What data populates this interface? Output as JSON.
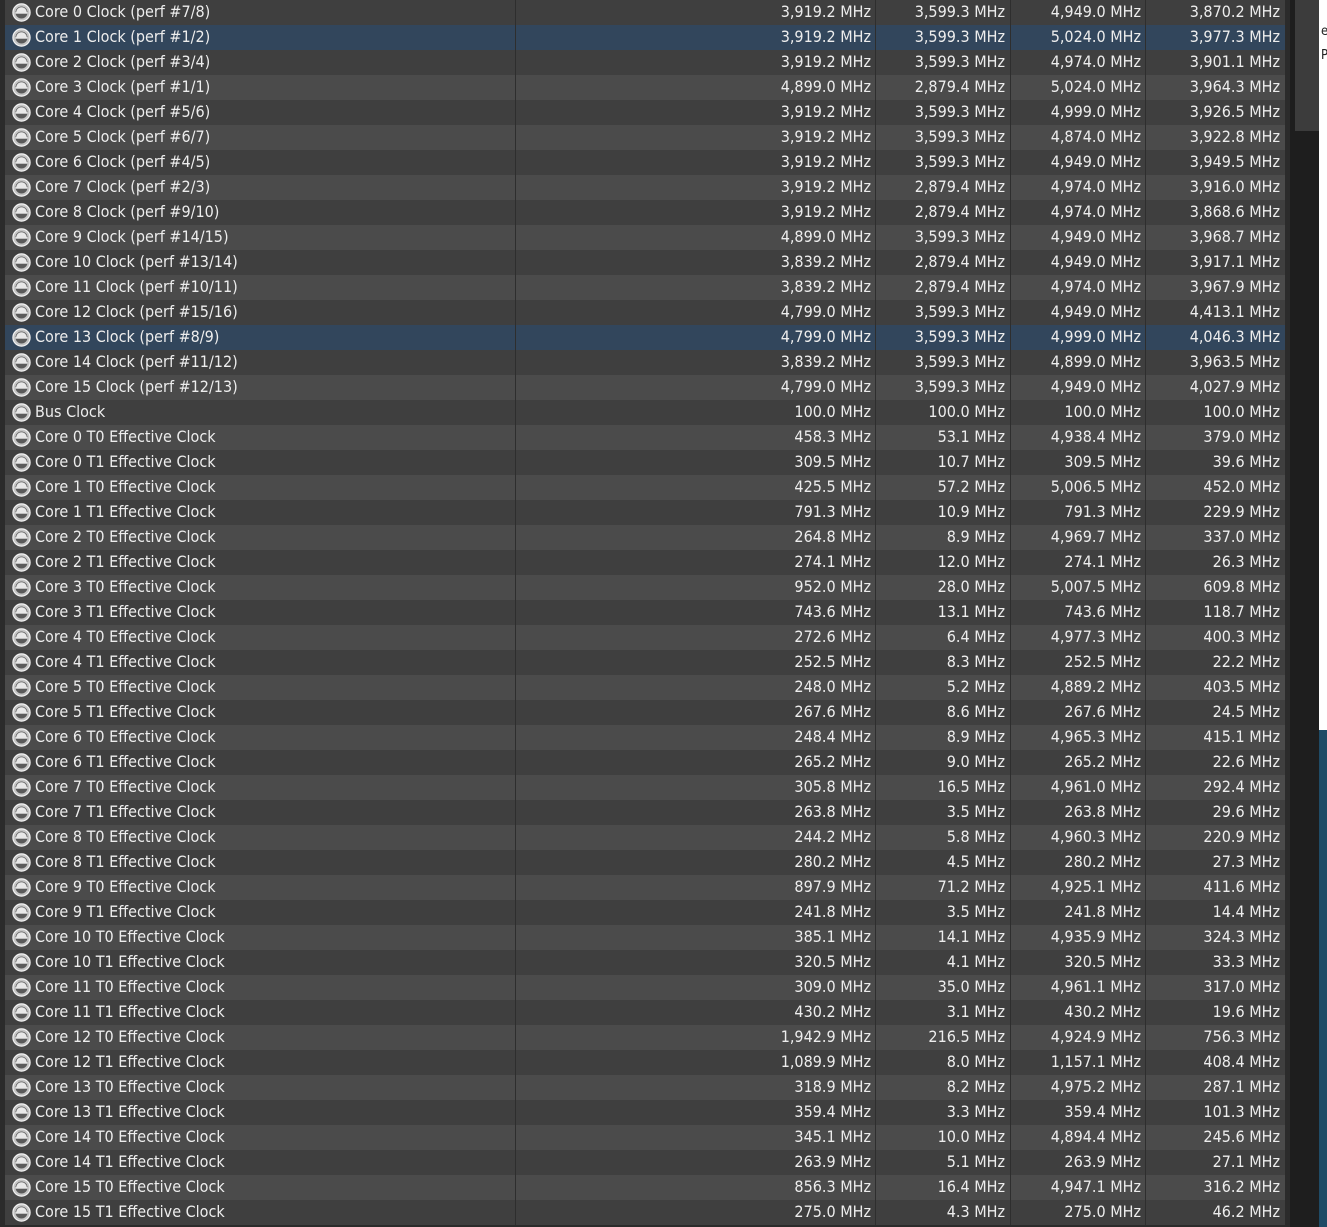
{
  "window_edge": [
    "e",
    "P"
  ],
  "rows": [
    {
      "name": "Core 0 Clock (perf #7/8)",
      "values": [
        "3,919.2 MHz",
        "3,599.3 MHz",
        "4,949.0 MHz",
        "3,870.2 MHz"
      ]
    },
    {
      "name": "Core 1 Clock (perf #1/2)",
      "values": [
        "3,919.2 MHz",
        "3,599.3 MHz",
        "5,024.0 MHz",
        "3,977.3 MHz"
      ],
      "selected": true
    },
    {
      "name": "Core 2 Clock (perf #3/4)",
      "values": [
        "3,919.2 MHz",
        "3,599.3 MHz",
        "4,974.0 MHz",
        "3,901.1 MHz"
      ]
    },
    {
      "name": "Core 3 Clock (perf #1/1)",
      "values": [
        "4,899.0 MHz",
        "2,879.4 MHz",
        "5,024.0 MHz",
        "3,964.3 MHz"
      ]
    },
    {
      "name": "Core 4 Clock (perf #5/6)",
      "values": [
        "3,919.2 MHz",
        "3,599.3 MHz",
        "4,999.0 MHz",
        "3,926.5 MHz"
      ]
    },
    {
      "name": "Core 5 Clock (perf #6/7)",
      "values": [
        "3,919.2 MHz",
        "3,599.3 MHz",
        "4,874.0 MHz",
        "3,922.8 MHz"
      ]
    },
    {
      "name": "Core 6 Clock (perf #4/5)",
      "values": [
        "3,919.2 MHz",
        "3,599.3 MHz",
        "4,949.0 MHz",
        "3,949.5 MHz"
      ]
    },
    {
      "name": "Core 7 Clock (perf #2/3)",
      "values": [
        "3,919.2 MHz",
        "2,879.4 MHz",
        "4,974.0 MHz",
        "3,916.0 MHz"
      ]
    },
    {
      "name": "Core 8 Clock (perf #9/10)",
      "values": [
        "3,919.2 MHz",
        "2,879.4 MHz",
        "4,974.0 MHz",
        "3,868.6 MHz"
      ]
    },
    {
      "name": "Core 9 Clock (perf #14/15)",
      "values": [
        "4,899.0 MHz",
        "3,599.3 MHz",
        "4,949.0 MHz",
        "3,968.7 MHz"
      ]
    },
    {
      "name": "Core 10 Clock (perf #13/14)",
      "values": [
        "3,839.2 MHz",
        "2,879.4 MHz",
        "4,949.0 MHz",
        "3,917.1 MHz"
      ]
    },
    {
      "name": "Core 11 Clock (perf #10/11)",
      "values": [
        "3,839.2 MHz",
        "2,879.4 MHz",
        "4,974.0 MHz",
        "3,967.9 MHz"
      ]
    },
    {
      "name": "Core 12 Clock (perf #15/16)",
      "values": [
        "4,799.0 MHz",
        "3,599.3 MHz",
        "4,949.0 MHz",
        "4,413.1 MHz"
      ]
    },
    {
      "name": "Core 13 Clock (perf #8/9)",
      "values": [
        "4,799.0 MHz",
        "3,599.3 MHz",
        "4,999.0 MHz",
        "4,046.3 MHz"
      ],
      "selected": true
    },
    {
      "name": "Core 14 Clock (perf #11/12)",
      "values": [
        "3,839.2 MHz",
        "3,599.3 MHz",
        "4,899.0 MHz",
        "3,963.5 MHz"
      ]
    },
    {
      "name": "Core 15 Clock (perf #12/13)",
      "values": [
        "4,799.0 MHz",
        "3,599.3 MHz",
        "4,949.0 MHz",
        "4,027.9 MHz"
      ]
    },
    {
      "name": "Bus Clock",
      "values": [
        "100.0 MHz",
        "100.0 MHz",
        "100.0 MHz",
        "100.0 MHz"
      ]
    },
    {
      "name": "Core 0 T0 Effective Clock",
      "values": [
        "458.3 MHz",
        "53.1 MHz",
        "4,938.4 MHz",
        "379.0 MHz"
      ]
    },
    {
      "name": "Core 0 T1 Effective Clock",
      "values": [
        "309.5 MHz",
        "10.7 MHz",
        "309.5 MHz",
        "39.6 MHz"
      ]
    },
    {
      "name": "Core 1 T0 Effective Clock",
      "values": [
        "425.5 MHz",
        "57.2 MHz",
        "5,006.5 MHz",
        "452.0 MHz"
      ]
    },
    {
      "name": "Core 1 T1 Effective Clock",
      "values": [
        "791.3 MHz",
        "10.9 MHz",
        "791.3 MHz",
        "229.9 MHz"
      ]
    },
    {
      "name": "Core 2 T0 Effective Clock",
      "values": [
        "264.8 MHz",
        "8.9 MHz",
        "4,969.7 MHz",
        "337.0 MHz"
      ]
    },
    {
      "name": "Core 2 T1 Effective Clock",
      "values": [
        "274.1 MHz",
        "12.0 MHz",
        "274.1 MHz",
        "26.3 MHz"
      ]
    },
    {
      "name": "Core 3 T0 Effective Clock",
      "values": [
        "952.0 MHz",
        "28.0 MHz",
        "5,007.5 MHz",
        "609.8 MHz"
      ]
    },
    {
      "name": "Core 3 T1 Effective Clock",
      "values": [
        "743.6 MHz",
        "13.1 MHz",
        "743.6 MHz",
        "118.7 MHz"
      ]
    },
    {
      "name": "Core 4 T0 Effective Clock",
      "values": [
        "272.6 MHz",
        "6.4 MHz",
        "4,977.3 MHz",
        "400.3 MHz"
      ]
    },
    {
      "name": "Core 4 T1 Effective Clock",
      "values": [
        "252.5 MHz",
        "8.3 MHz",
        "252.5 MHz",
        "22.2 MHz"
      ]
    },
    {
      "name": "Core 5 T0 Effective Clock",
      "values": [
        "248.0 MHz",
        "5.2 MHz",
        "4,889.2 MHz",
        "403.5 MHz"
      ]
    },
    {
      "name": "Core 5 T1 Effective Clock",
      "values": [
        "267.6 MHz",
        "8.6 MHz",
        "267.6 MHz",
        "24.5 MHz"
      ]
    },
    {
      "name": "Core 6 T0 Effective Clock",
      "values": [
        "248.4 MHz",
        "8.9 MHz",
        "4,965.3 MHz",
        "415.1 MHz"
      ]
    },
    {
      "name": "Core 6 T1 Effective Clock",
      "values": [
        "265.2 MHz",
        "9.0 MHz",
        "265.2 MHz",
        "22.6 MHz"
      ]
    },
    {
      "name": "Core 7 T0 Effective Clock",
      "values": [
        "305.8 MHz",
        "16.5 MHz",
        "4,961.0 MHz",
        "292.4 MHz"
      ]
    },
    {
      "name": "Core 7 T1 Effective Clock",
      "values": [
        "263.8 MHz",
        "3.5 MHz",
        "263.8 MHz",
        "29.6 MHz"
      ]
    },
    {
      "name": "Core 8 T0 Effective Clock",
      "values": [
        "244.2 MHz",
        "5.8 MHz",
        "4,960.3 MHz",
        "220.9 MHz"
      ]
    },
    {
      "name": "Core 8 T1 Effective Clock",
      "values": [
        "280.2 MHz",
        "4.5 MHz",
        "280.2 MHz",
        "27.3 MHz"
      ]
    },
    {
      "name": "Core 9 T0 Effective Clock",
      "values": [
        "897.9 MHz",
        "71.2 MHz",
        "4,925.1 MHz",
        "411.6 MHz"
      ]
    },
    {
      "name": "Core 9 T1 Effective Clock",
      "values": [
        "241.8 MHz",
        "3.5 MHz",
        "241.8 MHz",
        "14.4 MHz"
      ]
    },
    {
      "name": "Core 10 T0 Effective Clock",
      "values": [
        "385.1 MHz",
        "14.1 MHz",
        "4,935.9 MHz",
        "324.3 MHz"
      ]
    },
    {
      "name": "Core 10 T1 Effective Clock",
      "values": [
        "320.5 MHz",
        "4.1 MHz",
        "320.5 MHz",
        "33.3 MHz"
      ]
    },
    {
      "name": "Core 11 T0 Effective Clock",
      "values": [
        "309.0 MHz",
        "35.0 MHz",
        "4,961.1 MHz",
        "317.0 MHz"
      ]
    },
    {
      "name": "Core 11 T1 Effective Clock",
      "values": [
        "430.2 MHz",
        "3.1 MHz",
        "430.2 MHz",
        "19.6 MHz"
      ]
    },
    {
      "name": "Core 12 T0 Effective Clock",
      "values": [
        "1,942.9 MHz",
        "216.5 MHz",
        "4,924.9 MHz",
        "756.3 MHz"
      ]
    },
    {
      "name": "Core 12 T1 Effective Clock",
      "values": [
        "1,089.9 MHz",
        "8.0 MHz",
        "1,157.1 MHz",
        "408.4 MHz"
      ]
    },
    {
      "name": "Core 13 T0 Effective Clock",
      "values": [
        "318.9 MHz",
        "8.2 MHz",
        "4,975.2 MHz",
        "287.1 MHz"
      ]
    },
    {
      "name": "Core 13 T1 Effective Clock",
      "values": [
        "359.4 MHz",
        "3.3 MHz",
        "359.4 MHz",
        "101.3 MHz"
      ]
    },
    {
      "name": "Core 14 T0 Effective Clock",
      "values": [
        "345.1 MHz",
        "10.0 MHz",
        "4,894.4 MHz",
        "245.6 MHz"
      ]
    },
    {
      "name": "Core 14 T1 Effective Clock",
      "values": [
        "263.9 MHz",
        "5.1 MHz",
        "263.9 MHz",
        "27.1 MHz"
      ]
    },
    {
      "name": "Core 15 T0 Effective Clock",
      "values": [
        "856.3 MHz",
        "16.4 MHz",
        "4,947.1 MHz",
        "316.2 MHz"
      ]
    },
    {
      "name": "Core 15 T1 Effective Clock",
      "values": [
        "275.0 MHz",
        "4.3 MHz",
        "275.0 MHz",
        "46.2 MHz"
      ]
    }
  ],
  "icons": {
    "row_icon": "clock-gauge-icon"
  },
  "colors": {
    "row_even": "#4b4b4b",
    "row_odd": "#3f3f3f",
    "row_selected": "#32465c",
    "text": "#ededed"
  }
}
